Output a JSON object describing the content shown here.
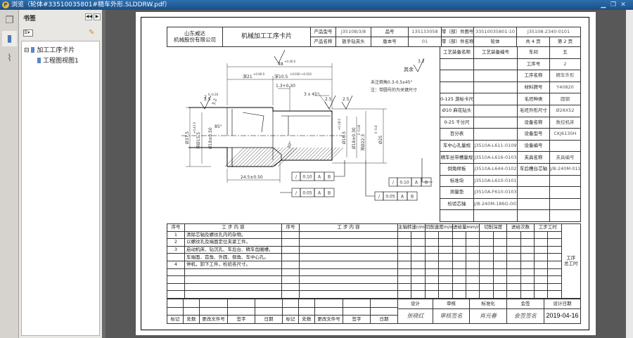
{
  "window": {
    "title": "浏览（轮体#33510035801#精车外形.SLDDRW.pdf）",
    "app_icon": "P",
    "minimize": "▁",
    "restore": "❐",
    "close": "✕"
  },
  "sidebar": {
    "panel_title": "书签",
    "tree": [
      {
        "label": "加工工序卡片",
        "expander": "⊟"
      },
      {
        "label": "工程图视图1"
      }
    ]
  },
  "titleblock": {
    "company": "山东威达\n机械股份有限公司",
    "title": "机械加工工序卡片",
    "product_model_label": "产品型号",
    "product_model": "J35108/3/8",
    "part_code_label": "品号",
    "part_code": "135133058",
    "part_no_label": "零（部）件图号",
    "part_no": "33510035801-10",
    "drawing_no": "J35108-2340-0101",
    "product_name_label": "产品名称",
    "product_name": "扳手钻夹头",
    "version_label": "版本号",
    "version": "01",
    "part_name_label": "零（部）件名称",
    "part_name": "轮体",
    "total_pages": "共 4 页",
    "page": "第 2 页"
  },
  "equipment": {
    "headers": [
      "工艺装备名称",
      "工艺装备编号",
      "车间",
      "五"
    ],
    "rows": [
      [
        "",
        "",
        "工序号",
        "2"
      ],
      [
        "",
        "",
        "工序名称",
        "精车外形"
      ],
      [
        "",
        "",
        "材料牌号",
        "Y40820"
      ],
      [
        "0-125 游标卡尺",
        "",
        "毛坯种类",
        "圆钢"
      ],
      [
        "Ø10 麻花钻头",
        "",
        "毛坯外形尺寸",
        "Ø28X52"
      ],
      [
        "0-25 千分尺",
        "",
        "设备名称",
        "数控机床"
      ],
      [
        "百分表",
        "",
        "设备型号",
        "CKJ6130H"
      ],
      [
        "车中心孔量规",
        "J3510A-L611-0109",
        "设备编号",
        ""
      ],
      [
        "精车丝带槽量规",
        "J3510A-L616-0103",
        "夹具名称",
        "夹具编号"
      ],
      [
        "倒角样板",
        "J3510A-L644-0102",
        "车后槽台芯轴",
        "J/B-240M-011-003"
      ],
      [
        "标准块",
        "J3510A-L610-0101",
        "",
        ""
      ],
      [
        "测量垫",
        "J3510A-F610-0103",
        "",
        ""
      ],
      [
        "检验芯轴",
        "J/B-240M-186G-003",
        "",
        ""
      ],
      [
        "",
        "",
        "",
        ""
      ]
    ]
  },
  "process": {
    "headers": {
      "no": "序号",
      "content": "工 步 内 容",
      "no2": "序号",
      "content2": "工 步 内 容",
      "spindle": "主轴转速r/min",
      "speed": "切削速度m/min",
      "feed": "进给量mm/r",
      "depth": "切削深度",
      "passes": "进给次数",
      "step_time": "工步工时",
      "total_time": "工序\n总工时"
    },
    "steps": [
      {
        "no": "1",
        "text": "清除芯轴及螺纹孔内的杂物。"
      },
      {
        "no": "2",
        "text": "以螺纹孔及端面定位夹紧工件。"
      },
      {
        "no": "3",
        "text": "启动机床、钻沉孔、车后台、精车齿圈槽，"
      },
      {
        "no": "",
        "text": "车端面、首角、外圆、倒角、车中心孔。"
      },
      {
        "no": "4",
        "text": "停机，卸下工件，检验各尺寸。"
      },
      {
        "no": "",
        "text": ""
      },
      {
        "no": "",
        "text": ""
      },
      {
        "no": "",
        "text": ""
      },
      {
        "no": "",
        "text": ""
      }
    ]
  },
  "changes": {
    "labels": [
      "标记",
      "处数",
      "更改文件号",
      "签字",
      "日期",
      "标记",
      "处数",
      "更改文件号",
      "签字",
      "日期"
    ]
  },
  "signoff": {
    "labels": [
      "设计",
      "审核",
      "标准化",
      "会签",
      "设计日期"
    ],
    "signatures": [
      "张晓红",
      "审核签名",
      "肖元春",
      "会签签名"
    ],
    "date": "2019-04-16"
  },
  "drawing": {
    "dim_48": "48",
    "tol_48": "+0.30 0",
    "dim_21": "深21",
    "tol_21": "+0.46 0",
    "dim_105": "深10.5",
    "tol_105": "+0.030 +0.010",
    "dim_13": "1.3+0.30",
    "dim_2": "2",
    "tol_2": "0 -0.20",
    "chamfer": "3 x 45°",
    "dim_375": "Ø37.5",
    "dim_155": "深Ø15.5",
    "tol_155": "+0.43 0",
    "dim_18l": "Ø18±0.50",
    "dim_165": "Ø16.5",
    "tol_165": "+0.18 0",
    "dim_18r": "Ø18±0.30",
    "dim_223": "深Ø22.3",
    "tol_223": "0 -0.08",
    "dim_25": "Ø25",
    "tol_25": "0 -0.8",
    "dim_245": "24.5±0.50",
    "angle_85": "85°",
    "angle_30": "30°",
    "rough_25": "2.5",
    "rough_32": "3.2",
    "rest_label": "其余",
    "rest_rough": "3.2",
    "note1": "未注倒角0.3-0.5x45°",
    "note2": "注：带圆号的为关键尺寸",
    "frames": [
      {
        "sym": "/",
        "tol": "0.10",
        "a": "A",
        "b": "B"
      },
      {
        "sym": "/",
        "tol": "0.05",
        "a": "A",
        "b": "B"
      },
      {
        "sym": "/",
        "tol": "0.10",
        "a": "A",
        "b": "B"
      },
      {
        "sym": "/",
        "tol": "0.05",
        "a": "A",
        "b": "B"
      }
    ]
  },
  "colors": {
    "titlebar": "#1b4f86",
    "workspace": "#585858"
  }
}
